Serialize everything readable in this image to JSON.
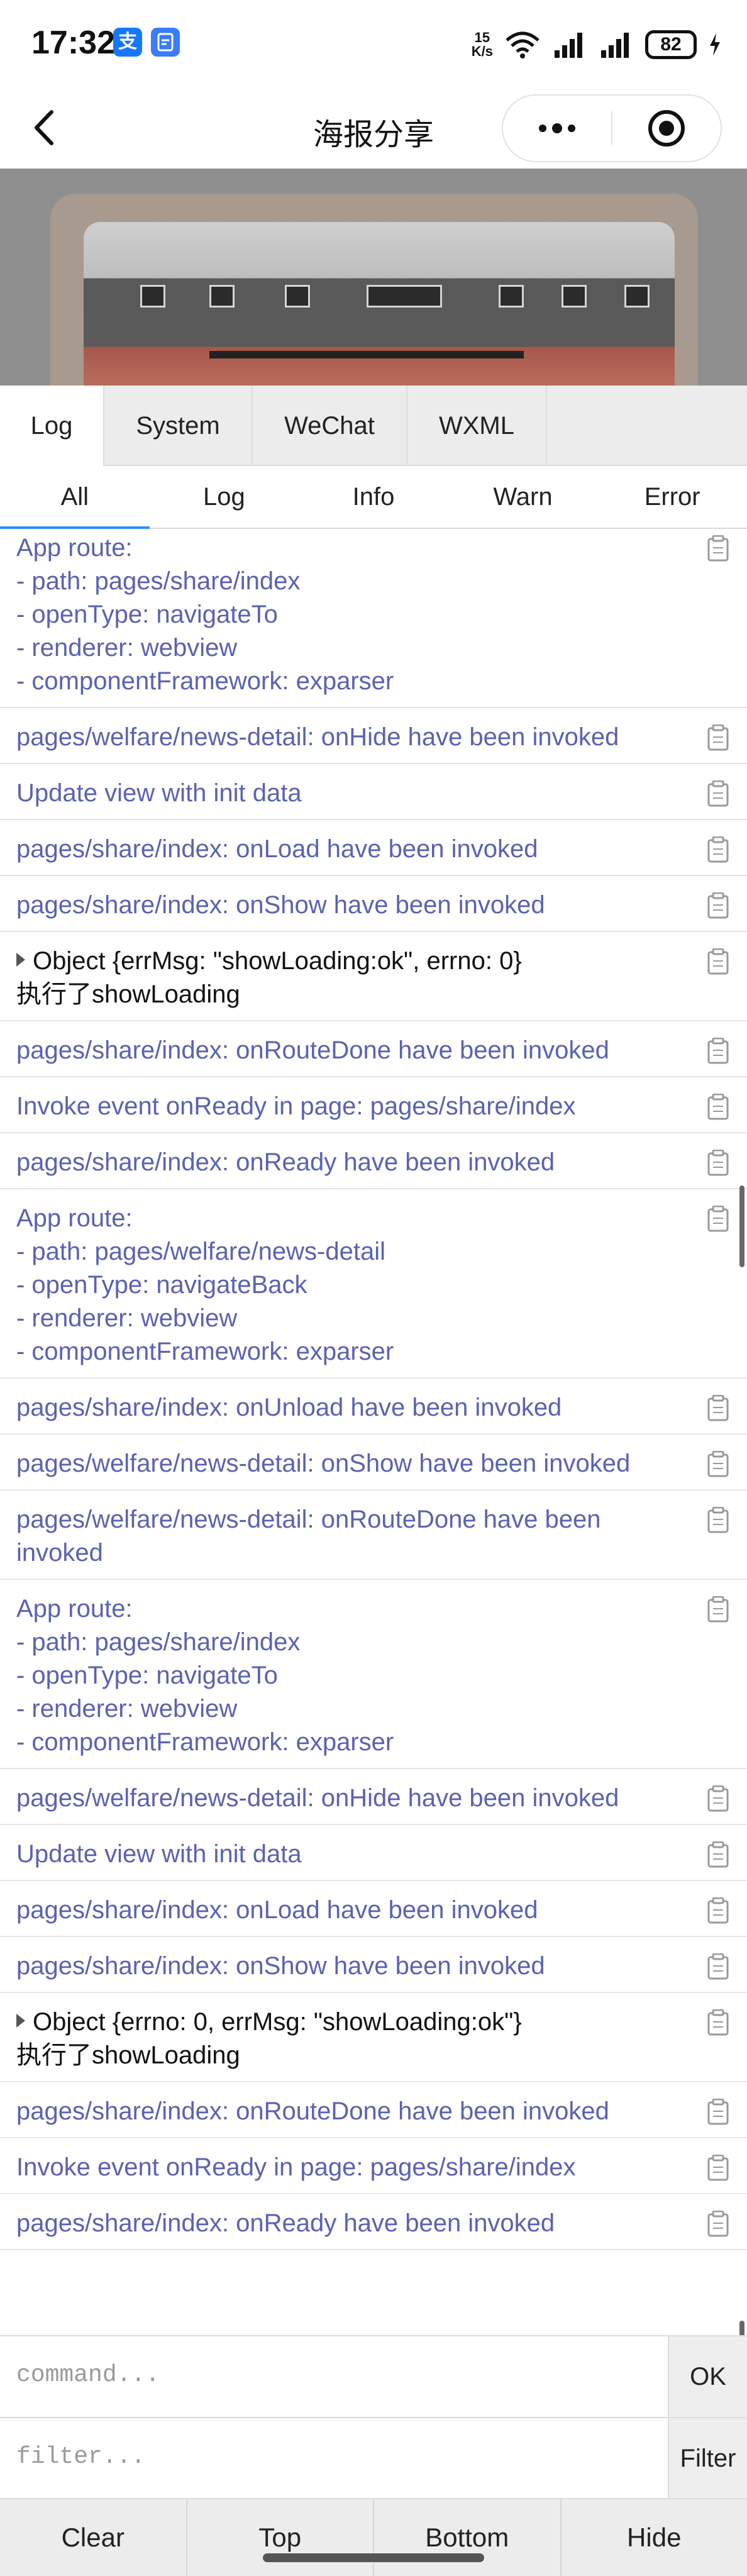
{
  "status_bar": {
    "time": "17:32",
    "speed_value": "15",
    "speed_unit": "K/s",
    "battery": "82"
  },
  "nav": {
    "title": "海报分享"
  },
  "console": {
    "tabs": [
      "Log",
      "System",
      "WeChat",
      "WXML"
    ],
    "subtabs": [
      "All",
      "Log",
      "Info",
      "Warn",
      "Error"
    ],
    "logs": [
      {
        "text": "App route:\n- path: pages/share/index\n- openType: navigateTo\n- renderer: webview\n- componentFramework: exparser"
      },
      {
        "text": "pages/welfare/news-detail: onHide have been invoked"
      },
      {
        "text": "Update view with init data"
      },
      {
        "text": "pages/share/index: onLoad have been invoked"
      },
      {
        "text": "pages/share/index: onShow have been invoked"
      },
      {
        "text": "Object {errMsg: \"showLoading:ok\", errno: 0}",
        "text2": "执行了showLoading"
      },
      {
        "text": "pages/share/index: onRouteDone have been invoked"
      },
      {
        "text": "Invoke event onReady in page: pages/share/index"
      },
      {
        "text": "pages/share/index: onReady have been invoked"
      },
      {
        "text": "App route:\n- path: pages/welfare/news-detail\n- openType: navigateBack\n- renderer: webview\n- componentFramework: exparser"
      },
      {
        "text": "pages/share/index: onUnload have been invoked"
      },
      {
        "text": "pages/welfare/news-detail: onShow have been invoked"
      },
      {
        "text": "pages/welfare/news-detail: onRouteDone have been\ninvoked"
      },
      {
        "text": "App route:\n- path: pages/share/index\n- openType: navigateTo\n- renderer: webview\n- componentFramework: exparser"
      },
      {
        "text": "pages/welfare/news-detail: onHide have been invoked"
      },
      {
        "text": "Update view with init data"
      },
      {
        "text": "pages/share/index: onLoad have been invoked"
      },
      {
        "text": "pages/share/index: onShow have been invoked"
      },
      {
        "text": "Object {errno: 0, errMsg: \"showLoading:ok\"}",
        "text2": "执行了showLoading"
      },
      {
        "text": "pages/share/index: onRouteDone have been invoked"
      },
      {
        "text": "Invoke event onReady in page: pages/share/index"
      },
      {
        "text": "pages/share/index: onReady have been invoked"
      }
    ],
    "command_placeholder": "command...",
    "ok_label": "OK",
    "filter_placeholder": "filter...",
    "filter_label": "Filter",
    "toolbar": [
      "Clear",
      "Top",
      "Bottom",
      "Hide"
    ]
  },
  "colors": {
    "log_text": "#5a62b0",
    "active_tab_underline": "#2a8cff"
  }
}
